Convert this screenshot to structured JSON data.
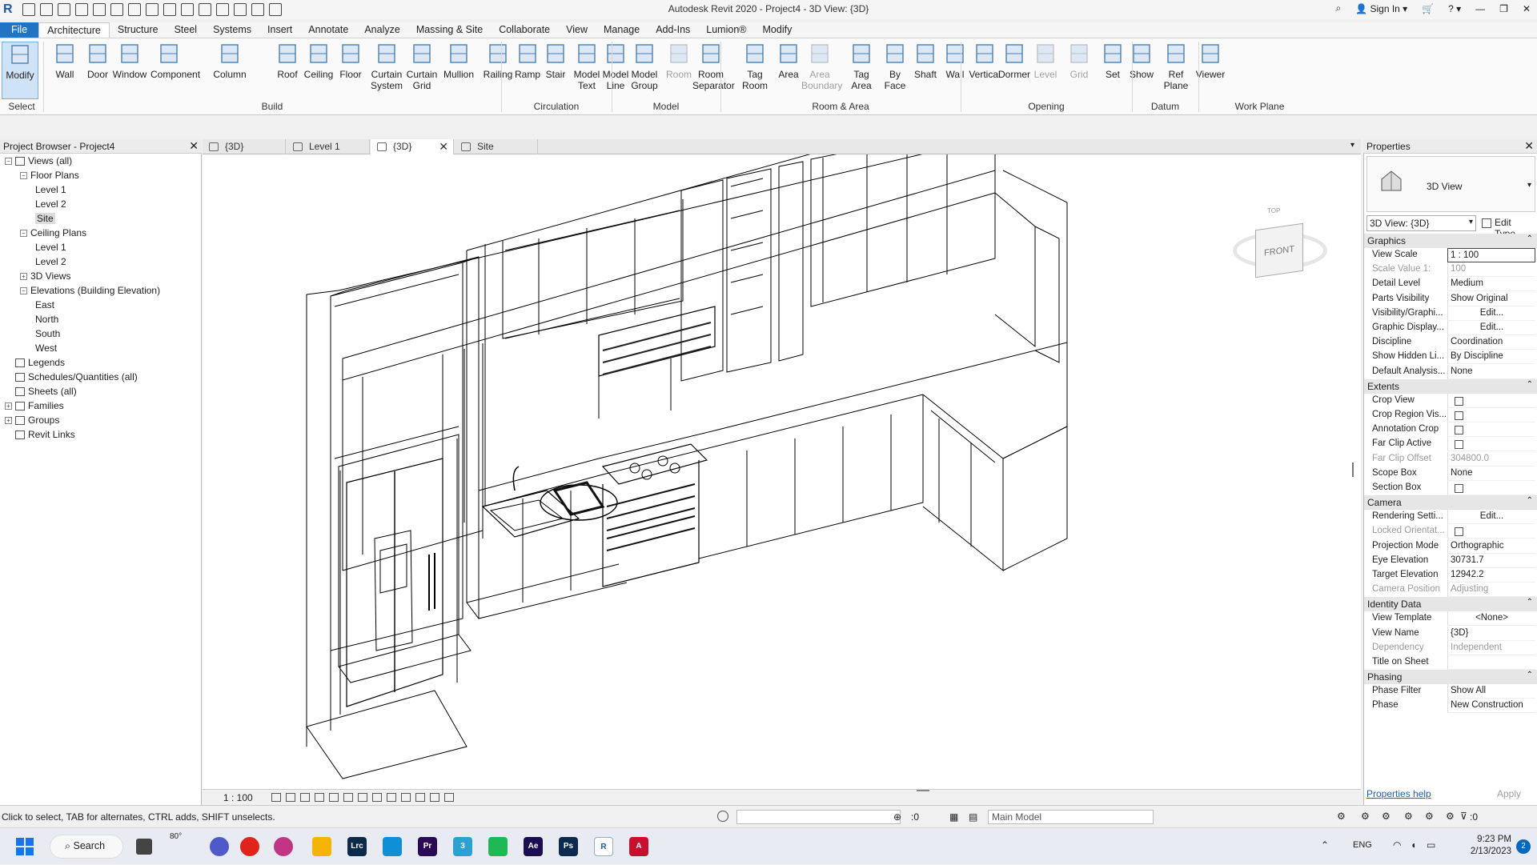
{
  "app": {
    "title": "Autodesk Revit 2020 - Project4 - 3D View: {3D}",
    "sign_in": "Sign In"
  },
  "menu": {
    "file": "File",
    "tabs": [
      "Architecture",
      "Structure",
      "Steel",
      "Systems",
      "Insert",
      "Annotate",
      "Analyze",
      "Massing & Site",
      "Collaborate",
      "View",
      "Manage",
      "Add-Ins",
      "Lumion®",
      "Modify"
    ]
  },
  "ribbon": {
    "buttons": [
      {
        "label": "Modify",
        "icon": "cursor-arrow-icon"
      },
      {
        "label": "Wall",
        "icon": "wall-icon"
      },
      {
        "label": "Door",
        "icon": "door-icon"
      },
      {
        "label": "Window",
        "icon": "window-icon"
      },
      {
        "label": "Component",
        "icon": "component-icon"
      },
      {
        "label": "Column",
        "icon": "column-icon"
      },
      {
        "label": "Roof",
        "icon": "roof-icon"
      },
      {
        "label": "Ceiling",
        "icon": "ceiling-icon"
      },
      {
        "label": "Floor",
        "icon": "floor-icon"
      },
      {
        "label": "Curtain\nSystem",
        "icon": "curtain-system-icon"
      },
      {
        "label": "Curtain\nGrid",
        "icon": "curtain-grid-icon"
      },
      {
        "label": "Mullion",
        "icon": "mullion-icon"
      },
      {
        "label": "Railing",
        "icon": "railing-icon"
      },
      {
        "label": "Ramp",
        "icon": "ramp-icon"
      },
      {
        "label": "Stair",
        "icon": "stair-icon"
      },
      {
        "label": "Model\nText",
        "icon": "model-text-icon"
      },
      {
        "label": "Model\nLine",
        "icon": "model-line-icon"
      },
      {
        "label": "Model\nGroup",
        "icon": "model-group-icon"
      },
      {
        "label": "Room",
        "icon": "room-icon"
      },
      {
        "label": "Room\nSeparator",
        "icon": "room-separator-icon"
      },
      {
        "label": "Tag\nRoom",
        "icon": "tag-room-icon"
      },
      {
        "label": "Area",
        "icon": "area-icon"
      },
      {
        "label": "Area\nBoundary",
        "icon": "area-boundary-icon"
      },
      {
        "label": "Tag\nArea",
        "icon": "tag-area-icon"
      },
      {
        "label": "By\nFace",
        "icon": "by-face-icon"
      },
      {
        "label": "Shaft",
        "icon": "shaft-icon"
      },
      {
        "label": "Wall",
        "icon": "wall-opening-icon"
      },
      {
        "label": "Vertical",
        "icon": "vertical-opening-icon"
      },
      {
        "label": "Dormer",
        "icon": "dormer-icon"
      },
      {
        "label": "Level",
        "icon": "level-icon"
      },
      {
        "label": "Grid",
        "icon": "grid-icon"
      },
      {
        "label": "Set",
        "icon": "set-workplane-icon"
      },
      {
        "label": "Show",
        "icon": "show-workplane-icon"
      },
      {
        "label": "Ref\nPlane",
        "icon": "ref-plane-icon"
      },
      {
        "label": "Viewer",
        "icon": "viewer-icon"
      }
    ],
    "panels": [
      "Select",
      "Build",
      "Circulation",
      "Model",
      "Room & Area",
      "Opening",
      "Datum",
      "Work Plane"
    ]
  },
  "project_browser": {
    "title": "Project Browser - Project4",
    "items": [
      {
        "label": "Views (all)",
        "level": 0,
        "toggle": "−"
      },
      {
        "label": "Floor Plans",
        "level": 1,
        "toggle": "−"
      },
      {
        "label": "Level 1",
        "level": 2
      },
      {
        "label": "Level 2",
        "level": 2
      },
      {
        "label": "Site",
        "level": 2,
        "selected": true
      },
      {
        "label": "Ceiling Plans",
        "level": 1,
        "toggle": "−"
      },
      {
        "label": "Level 1",
        "level": 2
      },
      {
        "label": "Level 2",
        "level": 2
      },
      {
        "label": "3D Views",
        "level": 1,
        "toggle": "+"
      },
      {
        "label": "Elevations (Building Elevation)",
        "level": 1,
        "toggle": "−"
      },
      {
        "label": "East",
        "level": 2
      },
      {
        "label": "North",
        "level": 2
      },
      {
        "label": "South",
        "level": 2
      },
      {
        "label": "West",
        "level": 2
      },
      {
        "label": "Legends",
        "level": 0,
        "icon": true
      },
      {
        "label": "Schedules/Quantities (all)",
        "level": 0,
        "icon": true
      },
      {
        "label": "Sheets (all)",
        "level": 0,
        "icon": true
      },
      {
        "label": "Families",
        "level": 0,
        "toggle": "+",
        "icon": true
      },
      {
        "label": "Groups",
        "level": 0,
        "toggle": "+",
        "icon": true
      },
      {
        "label": "Revit Links",
        "level": 0,
        "icon": true
      }
    ]
  },
  "view_tabs": [
    {
      "label": "{3D}",
      "active": false
    },
    {
      "label": "Level 1",
      "active": false
    },
    {
      "label": "{3D}",
      "active": true
    },
    {
      "label": "Site",
      "active": false
    }
  ],
  "viewcube": {
    "top": "TOP",
    "front": "FRONT"
  },
  "view_control": {
    "scale": "1 : 100"
  },
  "properties": {
    "title": "Properties",
    "type_name": "3D View",
    "instance": "3D View: {3D}",
    "edit_type": "Edit Type",
    "sections": [
      {
        "name": "Graphics",
        "rows": [
          {
            "name": "View Scale",
            "value": "1 : 100",
            "boxed": true
          },
          {
            "name": "Scale Value   1:",
            "value": "100",
            "dim": true
          },
          {
            "name": "Detail Level",
            "value": "Medium"
          },
          {
            "name": "Parts Visibility",
            "value": "Show Original"
          },
          {
            "name": "Visibility/Graphi...",
            "value": "Edit...",
            "center": true
          },
          {
            "name": "Graphic Display...",
            "value": "Edit...",
            "center": true
          },
          {
            "name": "Discipline",
            "value": "Coordination"
          },
          {
            "name": "Show Hidden Li...",
            "value": "By Discipline"
          },
          {
            "name": "Default Analysis...",
            "value": "None"
          }
        ]
      },
      {
        "name": "Extents",
        "rows": [
          {
            "name": "Crop View",
            "checkbox": true
          },
          {
            "name": "Crop Region Vis...",
            "checkbox": true
          },
          {
            "name": "Annotation Crop",
            "checkbox": true
          },
          {
            "name": "Far Clip Active",
            "checkbox": true
          },
          {
            "name": "Far Clip Offset",
            "value": "304800.0",
            "dim": true
          },
          {
            "name": "Scope Box",
            "value": "None"
          },
          {
            "name": "Section Box",
            "checkbox": true
          }
        ]
      },
      {
        "name": "Camera",
        "rows": [
          {
            "name": "Rendering Setti...",
            "value": "Edit...",
            "center": true
          },
          {
            "name": "Locked Orientat...",
            "checkbox": true,
            "dim": true
          },
          {
            "name": "Projection Mode",
            "value": "Orthographic"
          },
          {
            "name": "Eye Elevation",
            "value": "30731.7"
          },
          {
            "name": "Target Elevation",
            "value": "12942.2"
          },
          {
            "name": "Camera Position",
            "value": "Adjusting",
            "dim": true
          }
        ]
      },
      {
        "name": "Identity Data",
        "rows": [
          {
            "name": "View Template",
            "value": "<None>",
            "center": true
          },
          {
            "name": "View Name",
            "value": "{3D}"
          },
          {
            "name": "Dependency",
            "value": "Independent",
            "dim": true
          },
          {
            "name": "Title on Sheet",
            "value": ""
          }
        ]
      },
      {
        "name": "Phasing",
        "rows": [
          {
            "name": "Phase Filter",
            "value": "Show All"
          },
          {
            "name": "Phase",
            "value": "New Construction"
          }
        ]
      }
    ],
    "help": "Properties help",
    "apply": "Apply"
  },
  "status": {
    "message": "Click to select, TAB for alternates, CTRL adds, SHIFT unselects.",
    "pick_count": ":0",
    "model": "Main Model",
    "filter_count": ":0"
  },
  "taskbar": {
    "search": "Search",
    "weather": "80°",
    "lang": "ENG",
    "time": "9:23 PM",
    "date": "2/13/2023",
    "notifications": "2",
    "apps": [
      {
        "name": "file-explorer",
        "color": "#f4b400",
        "text": ""
      },
      {
        "name": "lightroom",
        "color": "#0b2a4a",
        "text": "Lrc"
      },
      {
        "name": "edge",
        "color": "#0f8fd6",
        "text": ""
      },
      {
        "name": "premiere",
        "color": "#2a0a52",
        "text": "Pr"
      },
      {
        "name": "app-3",
        "color": "#2aa1d0",
        "text": "3"
      },
      {
        "name": "spotify",
        "color": "#1db954",
        "text": ""
      },
      {
        "name": "after-effects",
        "color": "#1b0d4f",
        "text": "Ae"
      },
      {
        "name": "photoshop",
        "color": "#0a2a4f",
        "text": "Ps"
      },
      {
        "name": "revit",
        "color": "#ffffff",
        "text": "R"
      },
      {
        "name": "autocad",
        "color": "#c8102e",
        "text": "A"
      }
    ]
  }
}
